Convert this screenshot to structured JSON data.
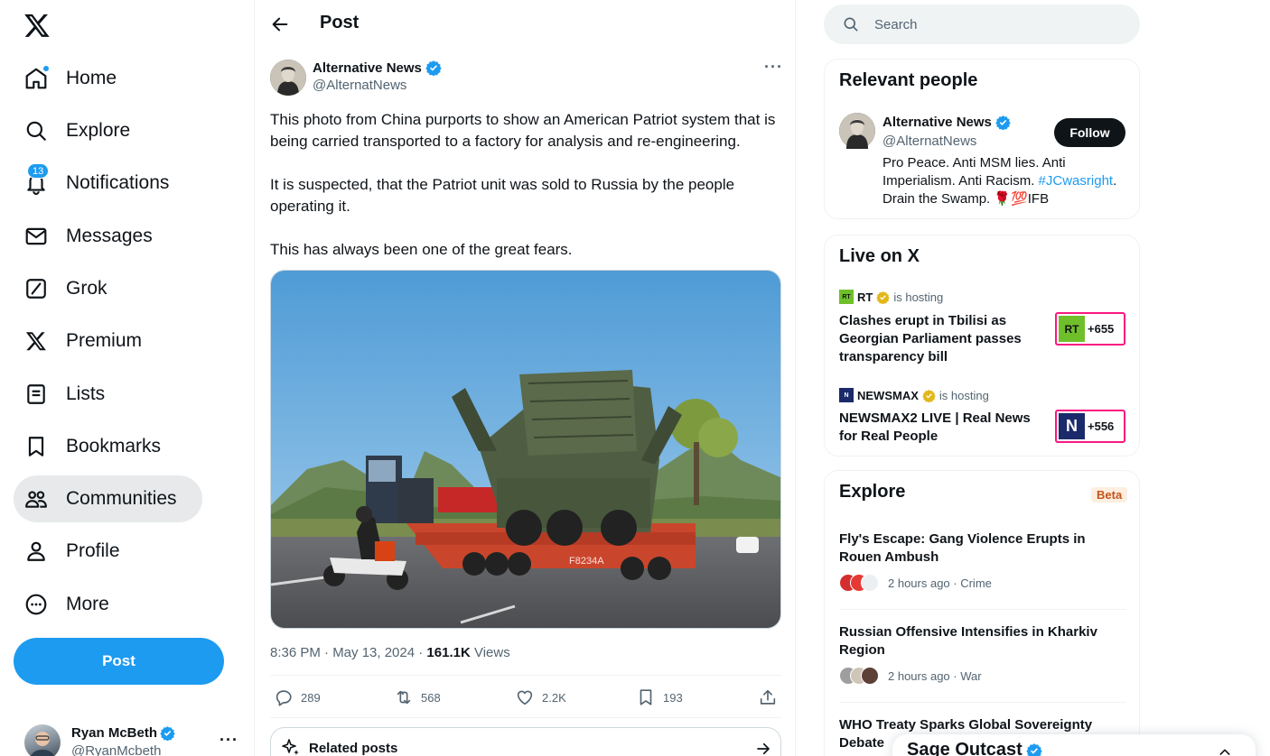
{
  "nav": {
    "items": [
      {
        "label": "Home",
        "icon": "home-icon"
      },
      {
        "label": "Explore",
        "icon": "search-icon"
      },
      {
        "label": "Notifications",
        "icon": "bell-icon",
        "badge": "13"
      },
      {
        "label": "Messages",
        "icon": "envelope-icon"
      },
      {
        "label": "Grok",
        "icon": "grok-icon"
      },
      {
        "label": "Premium",
        "icon": "x-logo-icon"
      },
      {
        "label": "Lists",
        "icon": "list-icon"
      },
      {
        "label": "Bookmarks",
        "icon": "bookmark-icon"
      },
      {
        "label": "Communities",
        "icon": "communities-icon"
      },
      {
        "label": "Profile",
        "icon": "person-icon"
      },
      {
        "label": "More",
        "icon": "more-circle-icon"
      }
    ],
    "post_button": "Post",
    "account": {
      "name": "Ryan McBeth",
      "handle": "@RyanMcbeth"
    }
  },
  "main": {
    "title": "Post",
    "tweet": {
      "author": "Alternative News",
      "handle": "@AlternatNews",
      "paragraphs": [
        "This photo from China purports to show an American Patriot system that is being carried transported to a factory for analysis and re-engineering.",
        "It is suspected, that the Patriot unit was sold to Russia by the people operating it.",
        "This has always been one of the great fears."
      ],
      "time": "8:36 PM · May 13, 2024 · ",
      "views_count": "161.1K",
      "views_label": " Views",
      "media_plate": "F8234A",
      "stats": {
        "replies": "289",
        "reposts": "568",
        "likes": "2.2K",
        "bookmarks": "193"
      }
    },
    "related_label": "Related posts"
  },
  "sidebar": {
    "search_placeholder": "Search",
    "relevant": {
      "title": "Relevant people",
      "name": "Alternative News",
      "handle": "@AlternatNews",
      "follow": "Follow",
      "bio_1": "Pro Peace. Anti MSM lies. Anti Imperialism. Anti Racism. ",
      "bio_link": "#JCwasright",
      "bio_2": ". Drain the Swamp. 🌹💯IFB"
    },
    "live": {
      "title": "Live on X",
      "items": [
        {
          "host": "RT",
          "hosting": "is hosting",
          "title": "Clashes erupt in Tbilisi as Georgian Parliament passes transparency bill",
          "count": "+655",
          "logo": "RT"
        },
        {
          "host": "NEWSMAX",
          "hosting": "is hosting",
          "title": "NEWSMAX2 LIVE | Real News for Real People",
          "count": "+556",
          "logo": "N"
        }
      ]
    },
    "explore": {
      "title": "Explore",
      "beta": "Beta",
      "trends": [
        {
          "title": "Fly's Escape: Gang Violence Erupts in Rouen Ambush",
          "meta": "2 hours ago · Crime"
        },
        {
          "title": "Russian Offensive Intensifies in Kharkiv Region",
          "meta": "2 hours ago · War"
        },
        {
          "title": "WHO Treaty Sparks Global Sovereignty Debate",
          "meta": ""
        }
      ]
    },
    "dm_drawer": {
      "name": "Sage Outcast"
    }
  },
  "colors": {
    "accent": "#1d9bf0",
    "text": "#0f1419",
    "muted": "#536471",
    "live_border": "#f91880",
    "verified_gold": "#e2b719"
  }
}
